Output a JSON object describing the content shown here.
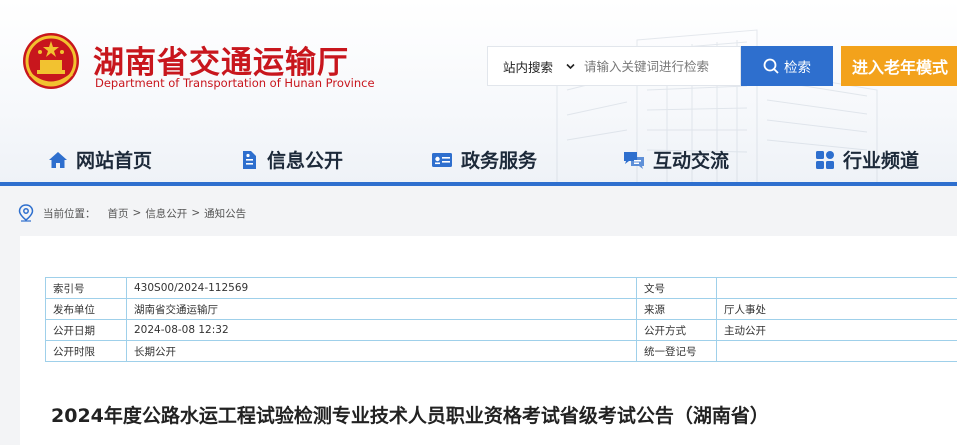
{
  "site": {
    "name": "湖南省交通运输厅",
    "name_en": "Department of Transportation of Hunan Province"
  },
  "search": {
    "scope": "站内搜索",
    "placeholder": "请输入关键词进行检索",
    "button_label": "检索"
  },
  "elder_mode_label": "进入老年模式",
  "nav": [
    {
      "label": "网站首页",
      "icon": "home-icon"
    },
    {
      "label": "信息公开",
      "icon": "document-icon"
    },
    {
      "label": "政务服务",
      "icon": "id-card-icon"
    },
    {
      "label": "互动交流",
      "icon": "chat-icon"
    },
    {
      "label": "行业频道",
      "icon": "grid-icon"
    }
  ],
  "breadcrumb": {
    "prefix": "当前位置：",
    "items": [
      "首页",
      "信息公开",
      "通知公告"
    ],
    "separator": ">"
  },
  "meta": {
    "index_no_label": "索引号",
    "index_no": "430S00/2024-112569",
    "doc_no_label": "文号",
    "doc_no": "",
    "publisher_label": "发布单位",
    "publisher": "湖南省交通运输厅",
    "source_label": "来源",
    "source": "厅人事处",
    "date_label": "公开日期",
    "date": "2024-08-08 12:32",
    "method_label": "公开方式",
    "method": "主动公开",
    "period_label": "公开时限",
    "period": "长期公开",
    "reg_no_label": "统一登记号",
    "reg_no": ""
  },
  "article_title": "2024年度公路水运工程试验检测专业技术人员职业资格考试省级考试公告（湖南省）",
  "colors": {
    "brand_red": "#c8161d",
    "accent_blue": "#2e6fce",
    "elder_orange": "#f3a21b",
    "table_border": "#9fd0ea"
  }
}
